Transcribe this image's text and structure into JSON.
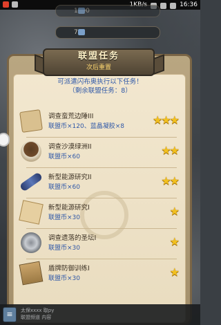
{
  "status_bar": {
    "speed": "1KB/s",
    "time": "16:36"
  },
  "resources": {
    "top_value": "1590",
    "mid_value": "73"
  },
  "dialog": {
    "title": "联盟任务",
    "subtitle": "次后重置",
    "intro": "可派遣闪布奥执行以下任务！",
    "remaining": "（剩余联盟任务：8）"
  },
  "tasks": [
    {
      "name": "调查蛮荒边陲III",
      "reward": "联盟币×120、蓝晶凝胶×8",
      "stars": 3,
      "icon": "treasure-map-icon"
    },
    {
      "name": "调查沙漠绿洲II",
      "reward": "联盟币×60",
      "stars": 2,
      "icon": "clam-shell-icon"
    },
    {
      "name": "新型能源研究II",
      "reward": "联盟币×60",
      "stars": 2,
      "icon": "energy-scroll-icon"
    },
    {
      "name": "新型能源研究I",
      "reward": "联盟币×30",
      "stars": 1,
      "icon": "research-paper-icon"
    },
    {
      "name": "调查遗落的圣坛I",
      "reward": "联盟币×30",
      "stars": 1,
      "icon": "altar-disc-icon"
    },
    {
      "name": "盾牌防御训练I",
      "reward": "联盟币×30",
      "stars": 1,
      "icon": "training-book-icon"
    }
  ],
  "chat": {
    "line1": "太保xxxx 取py",
    "line2": "联盟频道 内容"
  }
}
